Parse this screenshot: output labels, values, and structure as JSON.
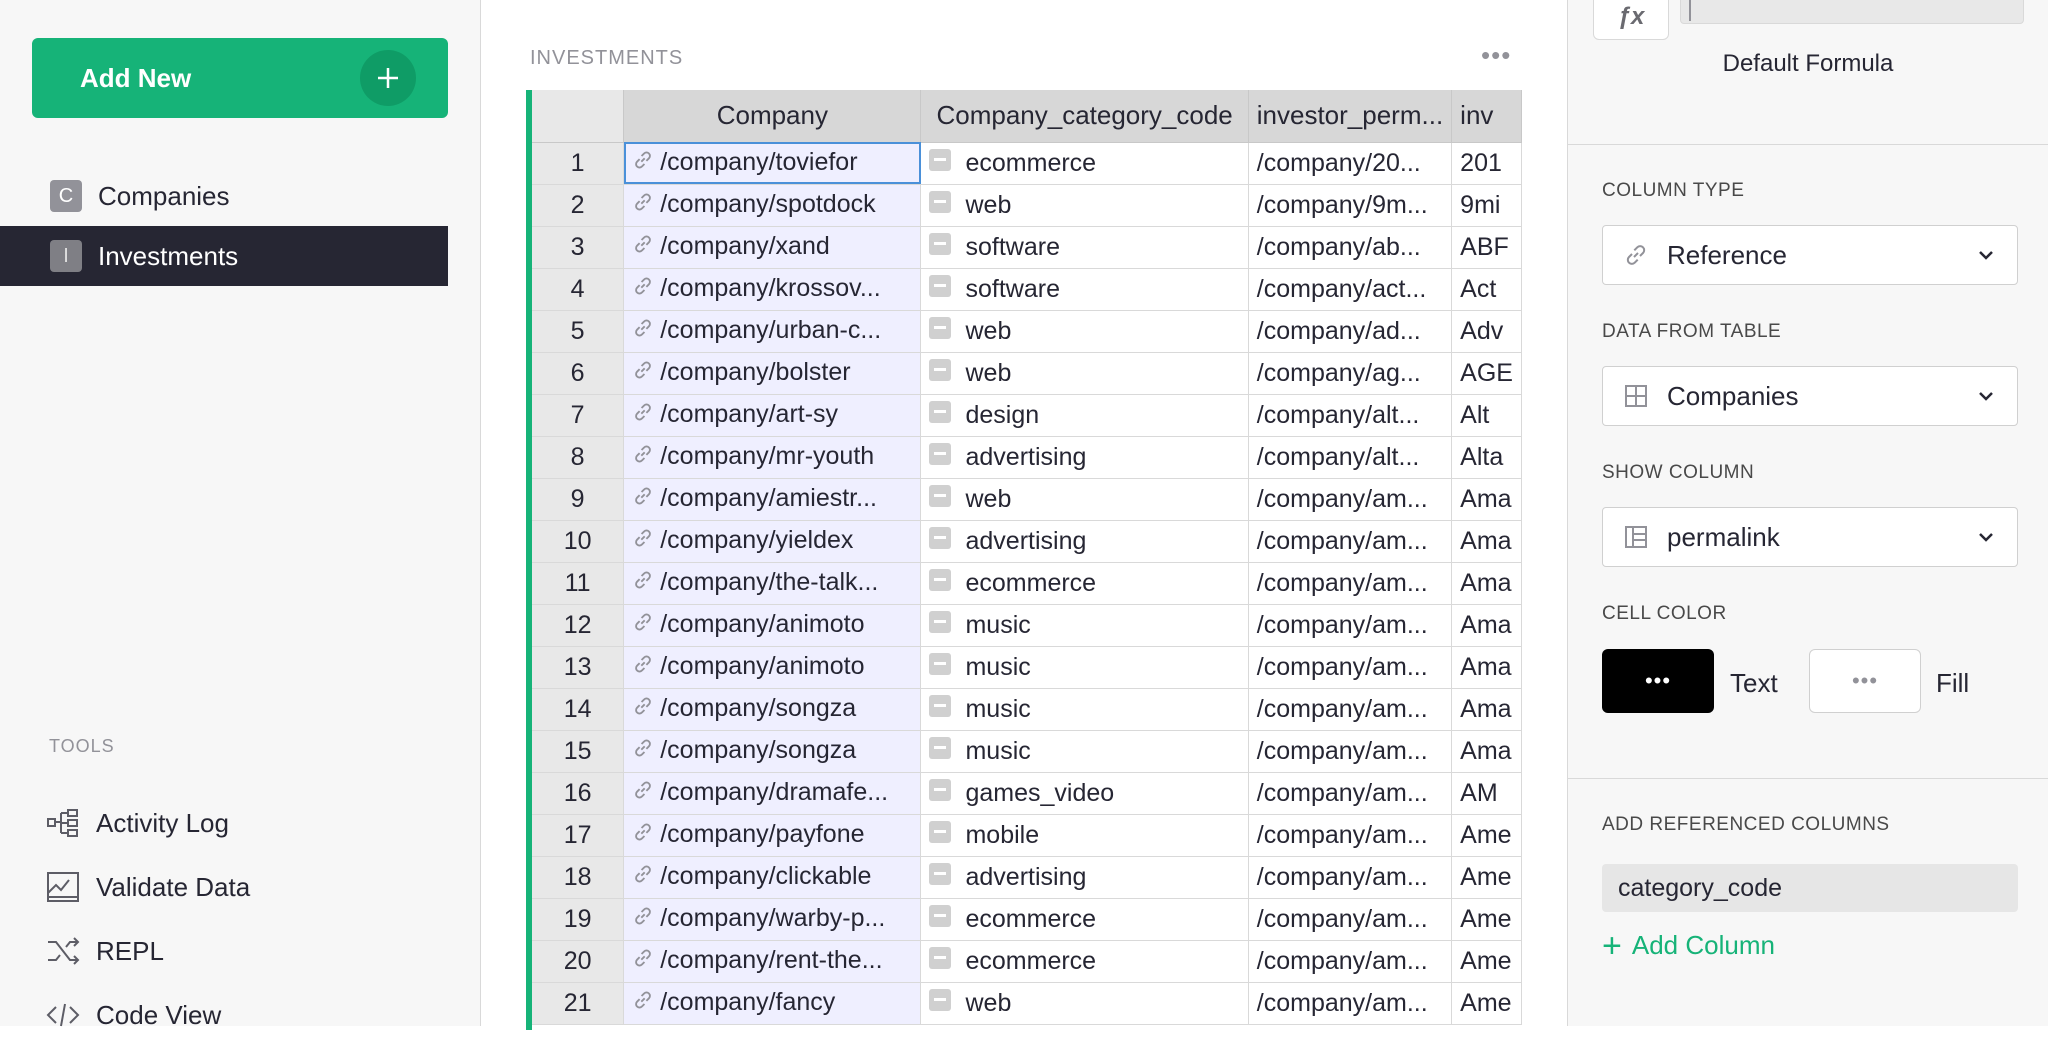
{
  "sidebar": {
    "add_new_label": "Add New",
    "pages": [
      {
        "badge": "C",
        "label": "Companies",
        "active": false
      },
      {
        "badge": "I",
        "label": "Investments",
        "active": true
      }
    ],
    "tools_title": "TOOLS",
    "tools": [
      {
        "icon": "activity-log-icon",
        "label": "Activity Log"
      },
      {
        "icon": "validate-data-icon",
        "label": "Validate Data"
      },
      {
        "icon": "repl-icon",
        "label": "REPL"
      },
      {
        "icon": "code-view-icon",
        "label": "Code View"
      }
    ]
  },
  "main": {
    "section_title": "INVESTMENTS",
    "more_icon": "more-dots-icon",
    "columns": [
      "Company",
      "Company_category_code",
      "investor_perm...",
      "inv"
    ],
    "rows": [
      {
        "n": "1",
        "company": "/company/toviefor",
        "cat": "ecommerce",
        "inv": "/company/20...",
        "inv2": "201"
      },
      {
        "n": "2",
        "company": "/company/spotdock",
        "cat": "web",
        "inv": "/company/9m...",
        "inv2": "9mi"
      },
      {
        "n": "3",
        "company": "/company/xand",
        "cat": "software",
        "inv": "/company/ab...",
        "inv2": "ABF"
      },
      {
        "n": "4",
        "company": "/company/krossov...",
        "cat": "software",
        "inv": "/company/act...",
        "inv2": "Act"
      },
      {
        "n": "5",
        "company": "/company/urban-c...",
        "cat": "web",
        "inv": "/company/ad...",
        "inv2": "Adv"
      },
      {
        "n": "6",
        "company": "/company/bolster",
        "cat": "web",
        "inv": "/company/ag...",
        "inv2": "AGE"
      },
      {
        "n": "7",
        "company": "/company/art-sy",
        "cat": "design",
        "inv": "/company/alt...",
        "inv2": "Alt"
      },
      {
        "n": "8",
        "company": "/company/mr-youth",
        "cat": "advertising",
        "inv": "/company/alt...",
        "inv2": "Alta"
      },
      {
        "n": "9",
        "company": "/company/amiestr...",
        "cat": "web",
        "inv": "/company/am...",
        "inv2": "Ama"
      },
      {
        "n": "10",
        "company": "/company/yieldex",
        "cat": "advertising",
        "inv": "/company/am...",
        "inv2": "Ama"
      },
      {
        "n": "11",
        "company": "/company/the-talk...",
        "cat": "ecommerce",
        "inv": "/company/am...",
        "inv2": "Ama"
      },
      {
        "n": "12",
        "company": "/company/animoto",
        "cat": "music",
        "inv": "/company/am...",
        "inv2": "Ama"
      },
      {
        "n": "13",
        "company": "/company/animoto",
        "cat": "music",
        "inv": "/company/am...",
        "inv2": "Ama"
      },
      {
        "n": "14",
        "company": "/company/songza",
        "cat": "music",
        "inv": "/company/am...",
        "inv2": "Ama"
      },
      {
        "n": "15",
        "company": "/company/songza",
        "cat": "music",
        "inv": "/company/am...",
        "inv2": "Ama"
      },
      {
        "n": "16",
        "company": "/company/dramafe...",
        "cat": "games_video",
        "inv": "/company/am...",
        "inv2": "AM"
      },
      {
        "n": "17",
        "company": "/company/payfone",
        "cat": "mobile",
        "inv": "/company/am...",
        "inv2": "Ame"
      },
      {
        "n": "18",
        "company": "/company/clickable",
        "cat": "advertising",
        "inv": "/company/am...",
        "inv2": "Ame"
      },
      {
        "n": "19",
        "company": "/company/warby-p...",
        "cat": "ecommerce",
        "inv": "/company/am...",
        "inv2": "Ame"
      },
      {
        "n": "20",
        "company": "/company/rent-the...",
        "cat": "ecommerce",
        "inv": "/company/am...",
        "inv2": "Ame"
      },
      {
        "n": "21",
        "company": "/company/fancy",
        "cat": "web",
        "inv": "/company/am...",
        "inv2": "Ame"
      }
    ]
  },
  "panel": {
    "fx_label": "ƒx",
    "default_formula": "Default Formula",
    "column_type_label": "COLUMN TYPE",
    "column_type_value": "Reference",
    "data_from_table_label": "DATA FROM TABLE",
    "data_from_table_value": "Companies",
    "show_column_label": "SHOW COLUMN",
    "show_column_value": "permalink",
    "cell_color_label": "CELL COLOR",
    "text_swatch_dots": "•••",
    "text_label": "Text",
    "fill_swatch_dots": "•••",
    "fill_label": "Fill",
    "text_color": "#000000",
    "fill_color": "#ffffff",
    "add_ref_cols_label": "ADD REFERENCED COLUMNS",
    "ref_columns": [
      "category_code"
    ],
    "add_column_label": "Add Column"
  },
  "colors": {
    "accent": "#16b378",
    "dark": "#262633",
    "ref_cell_bg": "#efefff"
  }
}
